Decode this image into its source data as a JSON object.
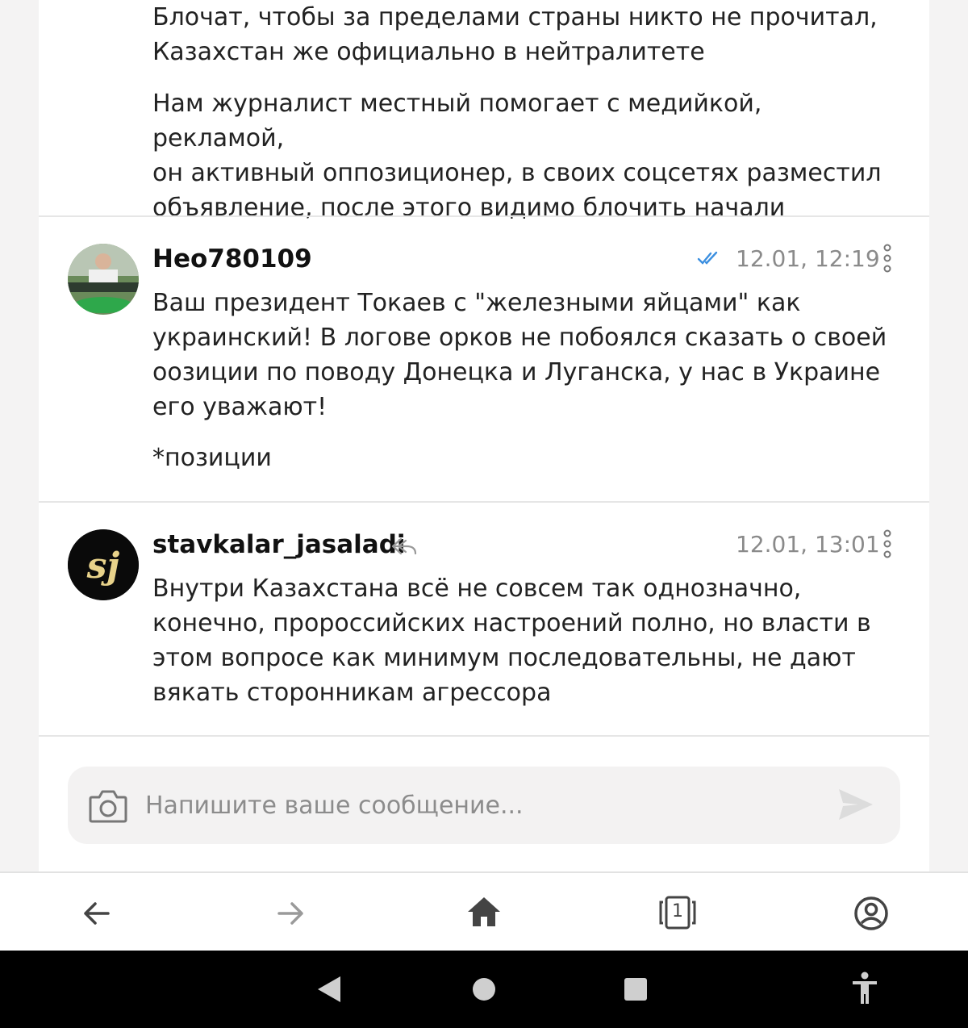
{
  "messages": [
    {
      "paragraphs": [
        "Блочат, чтобы за пределами страны никто не прочитал,\nКазахстан же официально в нейтралитете",
        "Нам журналист местный помогает с медийкой, рекламой,\nон активный оппозиционер, в своих соцсетях разместил\nобъявление, после этого видимо блочить начали"
      ]
    },
    {
      "username": "Нео780109",
      "time": "12.01, 12:19",
      "read_icon": "double-check-icon",
      "paragraphs": [
        "Ваш президент Токаев с \"железными яйцами\" как\nукраинский! В логове орков не побоялся сказать о своей\nоозиции по поводу Донецка и Луганска, у нас в Украине\nего уважают!",
        "*позиции"
      ]
    },
    {
      "username": "stavkalar_jasaladi",
      "time": "12.01, 13:01",
      "reply_icon": "reply-arrow-icon",
      "paragraphs": [
        "Внутри Казахстана всё не совсем так однозначно,\nконечно, пророссийских настроений полно, но власти в\nэтом вопросе как минимум последовательны, не дают\nвякать сторонникам агрессора"
      ]
    }
  ],
  "composer": {
    "placeholder": "Напишите ваше сообщение...",
    "value": ""
  },
  "browser_nav": {
    "tab_count": "1"
  },
  "colors": {
    "accent_check": "#3b8fe0",
    "muted": "#8a8a8a",
    "background": "#f4f3f3"
  }
}
